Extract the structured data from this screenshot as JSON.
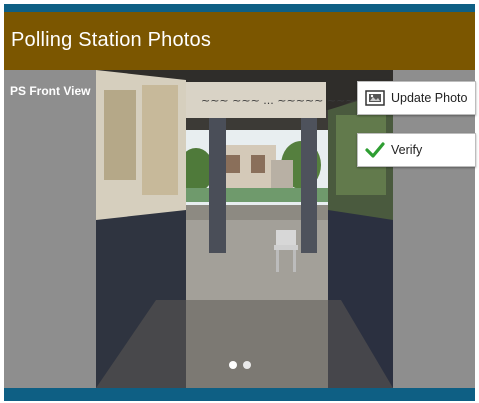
{
  "app_bar": {
    "title": "Polling Station Photos"
  },
  "photo_section": {
    "label": "PS Front View",
    "pager": {
      "total_pages": 2,
      "current_page": 1
    }
  },
  "actions": {
    "update_photo": {
      "label": "Update Photo",
      "icon": "photo-update-icon"
    },
    "verify": {
      "label": "Verify",
      "icon": "checkmark-icon"
    }
  },
  "colors": {
    "header_bar": "#7b5600",
    "accent_strip": "#0e5f84",
    "content_background": "#8e8e8e",
    "verify_check": "#2e9e32"
  }
}
